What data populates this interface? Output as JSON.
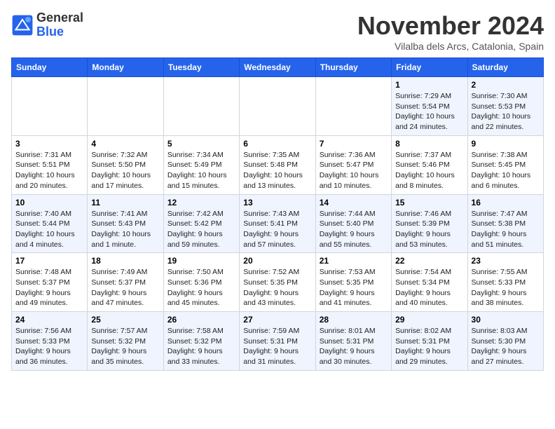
{
  "logo": {
    "line1": "General",
    "line2": "Blue"
  },
  "title": "November 2024",
  "subtitle": "Vilalba dels Arcs, Catalonia, Spain",
  "days_header": [
    "Sunday",
    "Monday",
    "Tuesday",
    "Wednesday",
    "Thursday",
    "Friday",
    "Saturday"
  ],
  "weeks": [
    [
      {
        "day": "",
        "detail": ""
      },
      {
        "day": "",
        "detail": ""
      },
      {
        "day": "",
        "detail": ""
      },
      {
        "day": "",
        "detail": ""
      },
      {
        "day": "",
        "detail": ""
      },
      {
        "day": "1",
        "detail": "Sunrise: 7:29 AM\nSunset: 5:54 PM\nDaylight: 10 hours and 24 minutes."
      },
      {
        "day": "2",
        "detail": "Sunrise: 7:30 AM\nSunset: 5:53 PM\nDaylight: 10 hours and 22 minutes."
      }
    ],
    [
      {
        "day": "3",
        "detail": "Sunrise: 7:31 AM\nSunset: 5:51 PM\nDaylight: 10 hours and 20 minutes."
      },
      {
        "day": "4",
        "detail": "Sunrise: 7:32 AM\nSunset: 5:50 PM\nDaylight: 10 hours and 17 minutes."
      },
      {
        "day": "5",
        "detail": "Sunrise: 7:34 AM\nSunset: 5:49 PM\nDaylight: 10 hours and 15 minutes."
      },
      {
        "day": "6",
        "detail": "Sunrise: 7:35 AM\nSunset: 5:48 PM\nDaylight: 10 hours and 13 minutes."
      },
      {
        "day": "7",
        "detail": "Sunrise: 7:36 AM\nSunset: 5:47 PM\nDaylight: 10 hours and 10 minutes."
      },
      {
        "day": "8",
        "detail": "Sunrise: 7:37 AM\nSunset: 5:46 PM\nDaylight: 10 hours and 8 minutes."
      },
      {
        "day": "9",
        "detail": "Sunrise: 7:38 AM\nSunset: 5:45 PM\nDaylight: 10 hours and 6 minutes."
      }
    ],
    [
      {
        "day": "10",
        "detail": "Sunrise: 7:40 AM\nSunset: 5:44 PM\nDaylight: 10 hours and 4 minutes."
      },
      {
        "day": "11",
        "detail": "Sunrise: 7:41 AM\nSunset: 5:43 PM\nDaylight: 10 hours and 1 minute."
      },
      {
        "day": "12",
        "detail": "Sunrise: 7:42 AM\nSunset: 5:42 PM\nDaylight: 9 hours and 59 minutes."
      },
      {
        "day": "13",
        "detail": "Sunrise: 7:43 AM\nSunset: 5:41 PM\nDaylight: 9 hours and 57 minutes."
      },
      {
        "day": "14",
        "detail": "Sunrise: 7:44 AM\nSunset: 5:40 PM\nDaylight: 9 hours and 55 minutes."
      },
      {
        "day": "15",
        "detail": "Sunrise: 7:46 AM\nSunset: 5:39 PM\nDaylight: 9 hours and 53 minutes."
      },
      {
        "day": "16",
        "detail": "Sunrise: 7:47 AM\nSunset: 5:38 PM\nDaylight: 9 hours and 51 minutes."
      }
    ],
    [
      {
        "day": "17",
        "detail": "Sunrise: 7:48 AM\nSunset: 5:37 PM\nDaylight: 9 hours and 49 minutes."
      },
      {
        "day": "18",
        "detail": "Sunrise: 7:49 AM\nSunset: 5:37 PM\nDaylight: 9 hours and 47 minutes."
      },
      {
        "day": "19",
        "detail": "Sunrise: 7:50 AM\nSunset: 5:36 PM\nDaylight: 9 hours and 45 minutes."
      },
      {
        "day": "20",
        "detail": "Sunrise: 7:52 AM\nSunset: 5:35 PM\nDaylight: 9 hours and 43 minutes."
      },
      {
        "day": "21",
        "detail": "Sunrise: 7:53 AM\nSunset: 5:35 PM\nDaylight: 9 hours and 41 minutes."
      },
      {
        "day": "22",
        "detail": "Sunrise: 7:54 AM\nSunset: 5:34 PM\nDaylight: 9 hours and 40 minutes."
      },
      {
        "day": "23",
        "detail": "Sunrise: 7:55 AM\nSunset: 5:33 PM\nDaylight: 9 hours and 38 minutes."
      }
    ],
    [
      {
        "day": "24",
        "detail": "Sunrise: 7:56 AM\nSunset: 5:33 PM\nDaylight: 9 hours and 36 minutes."
      },
      {
        "day": "25",
        "detail": "Sunrise: 7:57 AM\nSunset: 5:32 PM\nDaylight: 9 hours and 35 minutes."
      },
      {
        "day": "26",
        "detail": "Sunrise: 7:58 AM\nSunset: 5:32 PM\nDaylight: 9 hours and 33 minutes."
      },
      {
        "day": "27",
        "detail": "Sunrise: 7:59 AM\nSunset: 5:31 PM\nDaylight: 9 hours and 31 minutes."
      },
      {
        "day": "28",
        "detail": "Sunrise: 8:01 AM\nSunset: 5:31 PM\nDaylight: 9 hours and 30 minutes."
      },
      {
        "day": "29",
        "detail": "Sunrise: 8:02 AM\nSunset: 5:31 PM\nDaylight: 9 hours and 29 minutes."
      },
      {
        "day": "30",
        "detail": "Sunrise: 8:03 AM\nSunset: 5:30 PM\nDaylight: 9 hours and 27 minutes."
      }
    ]
  ]
}
